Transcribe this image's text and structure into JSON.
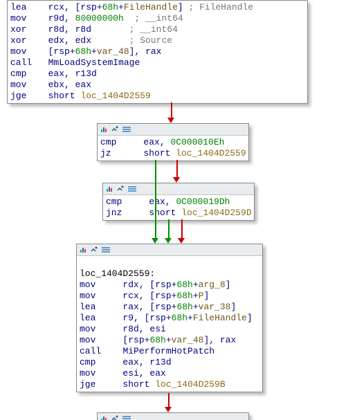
{
  "nodes": {
    "top": {
      "icons": [],
      "lines": [
        {
          "segs": [
            {
              "t": "lea",
              "c": "mnem"
            },
            {
              "t": "    "
            },
            {
              "t": "rcx, [rsp+",
              "c": "reg"
            },
            {
              "t": "68h",
              "c": "num"
            },
            {
              "t": "+",
              "c": "reg"
            },
            {
              "t": "FileHandle",
              "c": "var"
            },
            {
              "t": "]",
              "c": "reg"
            },
            {
              "t": " ; FileHandle",
              "c": "comm"
            }
          ]
        },
        {
          "segs": [
            {
              "t": "mov",
              "c": "mnem"
            },
            {
              "t": "    "
            },
            {
              "t": "r9d, ",
              "c": "reg"
            },
            {
              "t": "80000000h",
              "c": "num"
            },
            {
              "t": "  ; __int64",
              "c": "comm"
            }
          ]
        },
        {
          "segs": [
            {
              "t": "xor",
              "c": "mnem"
            },
            {
              "t": "    "
            },
            {
              "t": "r8d, r8d",
              "c": "reg"
            },
            {
              "t": "       ; __int64",
              "c": "comm"
            }
          ]
        },
        {
          "segs": [
            {
              "t": "xor",
              "c": "mnem"
            },
            {
              "t": "    "
            },
            {
              "t": "edx, edx",
              "c": "reg"
            },
            {
              "t": "       ; Source",
              "c": "comm"
            }
          ]
        },
        {
          "segs": [
            {
              "t": "mov",
              "c": "mnem"
            },
            {
              "t": "    "
            },
            {
              "t": "[rsp+",
              "c": "reg"
            },
            {
              "t": "68h",
              "c": "num"
            },
            {
              "t": "+",
              "c": "reg"
            },
            {
              "t": "var_48",
              "c": "var"
            },
            {
              "t": "], rax",
              "c": "reg"
            }
          ]
        },
        {
          "segs": [
            {
              "t": "call",
              "c": "mnem"
            },
            {
              "t": "   "
            },
            {
              "t": "MmLoadSystemImage",
              "c": "func"
            }
          ]
        },
        {
          "segs": [
            {
              "t": "cmp",
              "c": "mnem"
            },
            {
              "t": "    "
            },
            {
              "t": "eax, r13d",
              "c": "reg"
            }
          ]
        },
        {
          "segs": [
            {
              "t": "mov",
              "c": "mnem"
            },
            {
              "t": "    "
            },
            {
              "t": "ebx, eax",
              "c": "reg"
            }
          ]
        },
        {
          "segs": [
            {
              "t": "jge",
              "c": "mnem"
            },
            {
              "t": "    "
            },
            {
              "t": "short ",
              "c": "reg"
            },
            {
              "t": "loc_1404D2559",
              "c": "loc"
            }
          ]
        }
      ]
    },
    "n1": {
      "lines": [
        {
          "segs": [
            {
              "t": "cmp",
              "c": "mnem"
            },
            {
              "t": "     "
            },
            {
              "t": "eax, ",
              "c": "reg"
            },
            {
              "t": "0C000010Eh",
              "c": "num"
            }
          ]
        },
        {
          "segs": [
            {
              "t": "jz",
              "c": "mnem"
            },
            {
              "t": "      "
            },
            {
              "t": "short ",
              "c": "reg"
            },
            {
              "t": "loc_1404D2559",
              "c": "loc"
            }
          ]
        }
      ]
    },
    "n2": {
      "lines": [
        {
          "segs": [
            {
              "t": "cmp",
              "c": "mnem"
            },
            {
              "t": "     "
            },
            {
              "t": "eax, ",
              "c": "reg"
            },
            {
              "t": "0C000019Dh",
              "c": "num"
            }
          ]
        },
        {
          "segs": [
            {
              "t": "jnz",
              "c": "mnem"
            },
            {
              "t": "     "
            },
            {
              "t": "short ",
              "c": "reg"
            },
            {
              "t": "loc_1404D259D",
              "c": "loc"
            }
          ]
        }
      ]
    },
    "n3": {
      "lines": [
        {
          "segs": [
            {
              "t": " ",
              "c": "reg"
            }
          ]
        },
        {
          "segs": [
            {
              "t": "loc_1404D2559:",
              "c": "black"
            }
          ]
        },
        {
          "segs": [
            {
              "t": "mov",
              "c": "mnem"
            },
            {
              "t": "     "
            },
            {
              "t": "rdx, [rsp+",
              "c": "reg"
            },
            {
              "t": "68h",
              "c": "num"
            },
            {
              "t": "+",
              "c": "reg"
            },
            {
              "t": "arg_8",
              "c": "var"
            },
            {
              "t": "]",
              "c": "reg"
            }
          ]
        },
        {
          "segs": [
            {
              "t": "mov",
              "c": "mnem"
            },
            {
              "t": "     "
            },
            {
              "t": "rcx, [rsp+",
              "c": "reg"
            },
            {
              "t": "68h",
              "c": "num"
            },
            {
              "t": "+",
              "c": "reg"
            },
            {
              "t": "P",
              "c": "var"
            },
            {
              "t": "]",
              "c": "reg"
            }
          ]
        },
        {
          "segs": [
            {
              "t": "lea",
              "c": "mnem"
            },
            {
              "t": "     "
            },
            {
              "t": "rax, [rsp+",
              "c": "reg"
            },
            {
              "t": "68h",
              "c": "num"
            },
            {
              "t": "+",
              "c": "reg"
            },
            {
              "t": "var_38",
              "c": "var"
            },
            {
              "t": "]",
              "c": "reg"
            }
          ]
        },
        {
          "segs": [
            {
              "t": "lea",
              "c": "mnem"
            },
            {
              "t": "     "
            },
            {
              "t": "r9, [rsp+",
              "c": "reg"
            },
            {
              "t": "68h",
              "c": "num"
            },
            {
              "t": "+",
              "c": "reg"
            },
            {
              "t": "FileHandle",
              "c": "var"
            },
            {
              "t": "]",
              "c": "reg"
            }
          ]
        },
        {
          "segs": [
            {
              "t": "mov",
              "c": "mnem"
            },
            {
              "t": "     "
            },
            {
              "t": "r8d, esi",
              "c": "reg"
            }
          ]
        },
        {
          "segs": [
            {
              "t": "mov",
              "c": "mnem"
            },
            {
              "t": "     "
            },
            {
              "t": "[rsp+",
              "c": "reg"
            },
            {
              "t": "68h",
              "c": "num"
            },
            {
              "t": "+",
              "c": "reg"
            },
            {
              "t": "var_48",
              "c": "var"
            },
            {
              "t": "], rax",
              "c": "reg"
            }
          ]
        },
        {
          "segs": [
            {
              "t": "call",
              "c": "mnem"
            },
            {
              "t": "    "
            },
            {
              "t": "MiPerformHotPatch",
              "c": "func"
            }
          ]
        },
        {
          "segs": [
            {
              "t": "cmp",
              "c": "mnem"
            },
            {
              "t": "     "
            },
            {
              "t": "eax, r13d",
              "c": "reg"
            }
          ]
        },
        {
          "segs": [
            {
              "t": "mov",
              "c": "mnem"
            },
            {
              "t": "     "
            },
            {
              "t": "esi, eax",
              "c": "reg"
            }
          ]
        },
        {
          "segs": [
            {
              "t": "jge",
              "c": "mnem"
            },
            {
              "t": "     "
            },
            {
              "t": "short ",
              "c": "reg"
            },
            {
              "t": "loc_1404D259B",
              "c": "loc"
            }
          ]
        }
      ]
    }
  },
  "colors": {
    "red": "#c80000",
    "green": "#009000"
  }
}
